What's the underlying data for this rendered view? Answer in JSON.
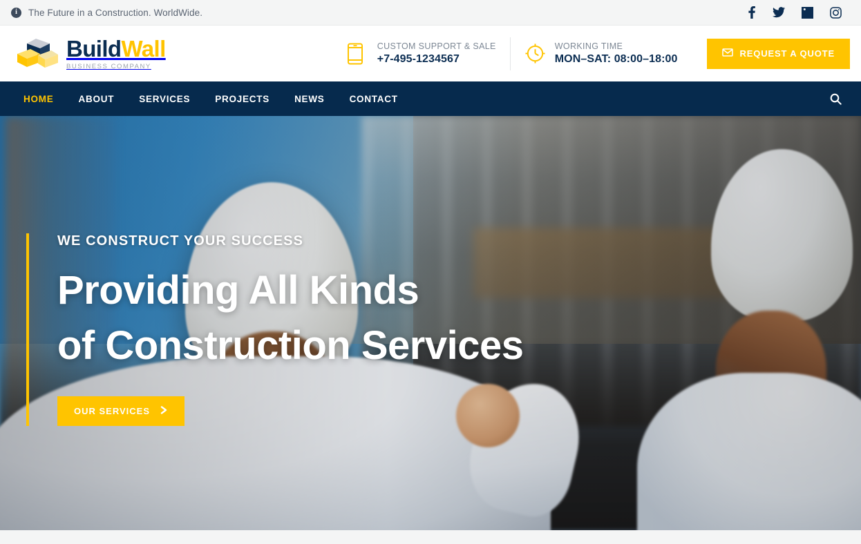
{
  "topbar": {
    "icon": "info-circle-icon",
    "tagline": "The Future in a Construction. WorldWide.",
    "socials": [
      {
        "name": "facebook-icon",
        "label": "Facebook"
      },
      {
        "name": "twitter-icon",
        "label": "Twitter"
      },
      {
        "name": "linkedin-icon",
        "label": "LinkedIn"
      },
      {
        "name": "instagram-icon",
        "label": "Instagram"
      }
    ]
  },
  "header": {
    "logo": {
      "name_primary": "Build",
      "name_accent": "Wall",
      "tagline": "BUSINESS COMPANY"
    },
    "phone_block": {
      "icon": "mobile-phone-icon",
      "label": "CUSTOM SUPPORT & SALE",
      "value": "+7-495-1234567"
    },
    "hours_block": {
      "icon": "clock-icon",
      "label": "WORKING TIME",
      "value": "MON–SAT: 08:00–18:00"
    },
    "quote_button": {
      "icon": "envelope-icon",
      "label": "REQUEST A QUOTE"
    }
  },
  "nav": {
    "items": [
      {
        "label": "HOME",
        "active": true
      },
      {
        "label": "ABOUT",
        "active": false
      },
      {
        "label": "SERVICES",
        "active": false
      },
      {
        "label": "PROJECTS",
        "active": false
      },
      {
        "label": "NEWS",
        "active": false
      },
      {
        "label": "CONTACT",
        "active": false
      }
    ],
    "search_icon": "search-icon"
  },
  "hero": {
    "eyebrow": "WE CONSTRUCT YOUR SUCCESS",
    "title_line1": "Providing All Kinds",
    "title_line2": "of Construction Services",
    "button_label": "OUR SERVICES",
    "button_icon": "chevron-right-icon",
    "image_description": "Two construction workers in white hard hats at a building site"
  },
  "colors": {
    "navy": "#062a4d",
    "yellow": "#ffc400",
    "top_bar_bg": "#f4f5f5",
    "header_bg": "#ffffff",
    "muted_text": "#7c8794"
  }
}
